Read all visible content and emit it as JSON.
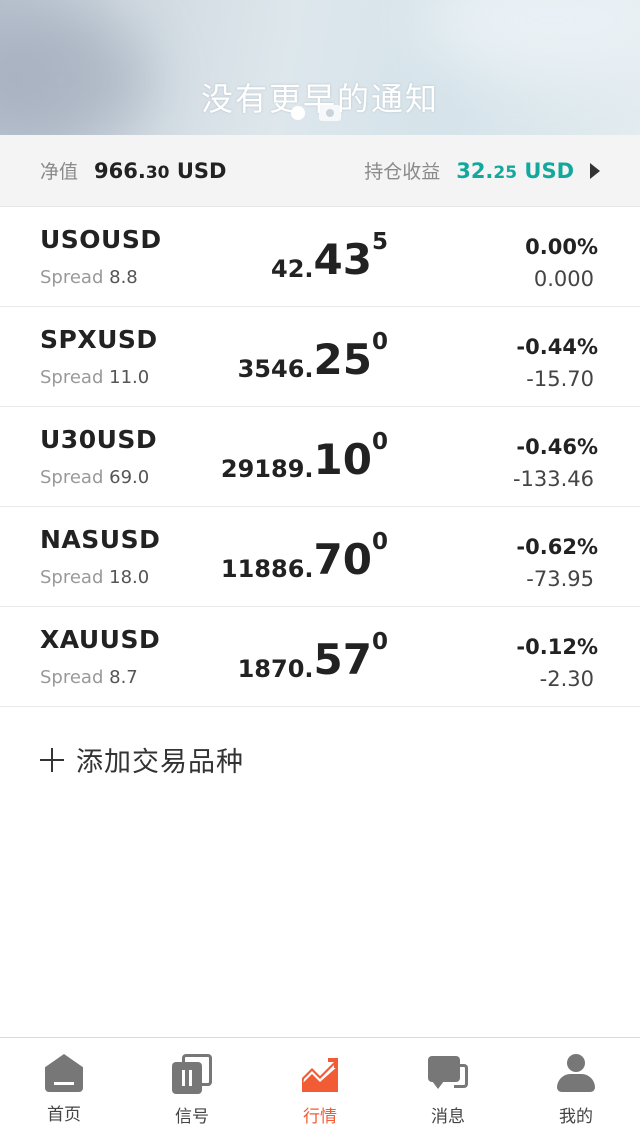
{
  "notification": {
    "text": "没有更早的通知"
  },
  "summary": {
    "equity_label": "净值",
    "equity_main": "966.",
    "equity_small": "30",
    "equity_currency": " USD",
    "pnl_label": "持仓收益",
    "pnl_main": "32.",
    "pnl_small": "25",
    "pnl_currency": " USD",
    "pnl_color": "#13a89e"
  },
  "quotes": [
    {
      "symbol": "USOUSD",
      "spread_label": "Spread",
      "spread": "8.8",
      "price_small": "42.",
      "price_big": "43",
      "price_sup": "5",
      "change_pct": "0.00%",
      "change": "0.000"
    },
    {
      "symbol": "SPXUSD",
      "spread_label": "Spread",
      "spread": "11.0",
      "price_small": "3546.",
      "price_big": "25",
      "price_sup": "0",
      "change_pct": "-0.44%",
      "change": "-15.70"
    },
    {
      "symbol": "U30USD",
      "spread_label": "Spread",
      "spread": "69.0",
      "price_small": "29189.",
      "price_big": "10",
      "price_sup": "0",
      "change_pct": "-0.46%",
      "change": "-133.46"
    },
    {
      "symbol": "NASUSD",
      "spread_label": "Spread",
      "spread": "18.0",
      "price_small": "11886.",
      "price_big": "70",
      "price_sup": "0",
      "change_pct": "-0.62%",
      "change": "-73.95"
    },
    {
      "symbol": "XAUUSD",
      "spread_label": "Spread",
      "spread": "8.7",
      "price_small": "1870.",
      "price_big": "57",
      "price_sup": "0",
      "change_pct": "-0.12%",
      "change": "-2.30"
    }
  ],
  "add_instrument": {
    "label": "添加交易品种"
  },
  "tabs": [
    {
      "label": "首页",
      "icon": "home-icon"
    },
    {
      "label": "信号",
      "icon": "signal-icon"
    },
    {
      "label": "行情",
      "icon": "chart-icon",
      "active": true
    },
    {
      "label": "消息",
      "icon": "message-icon"
    },
    {
      "label": "我的",
      "icon": "user-icon"
    }
  ],
  "colors": {
    "accent": "#f25c35",
    "profit": "#13a89e"
  }
}
